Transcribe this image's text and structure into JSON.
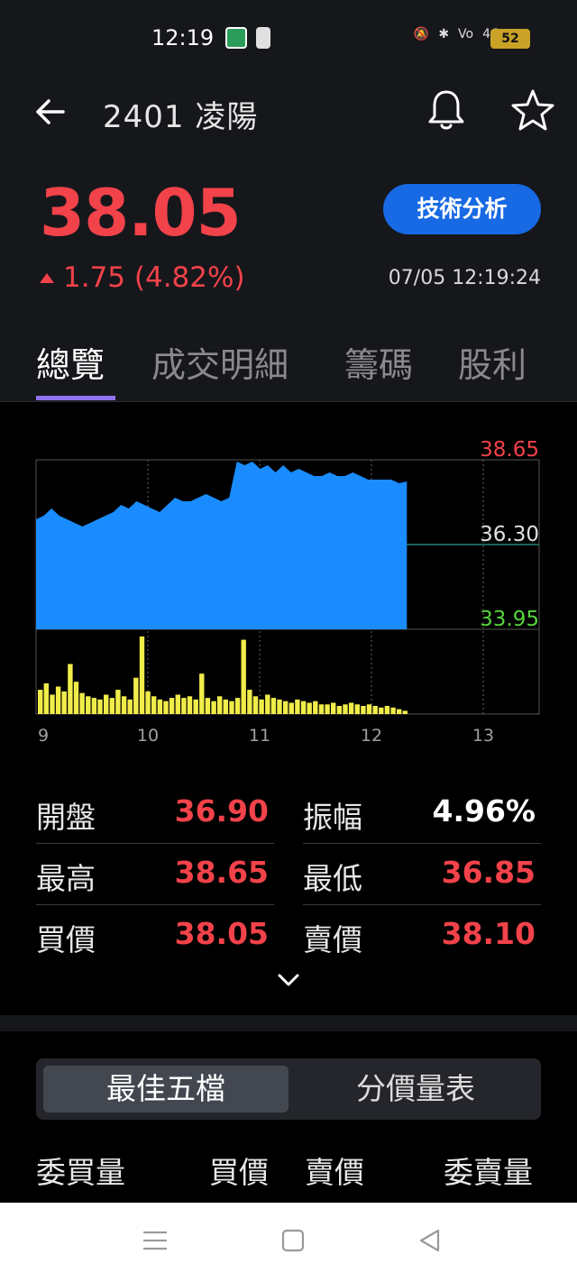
{
  "status": {
    "time": "12:19",
    "network": "4G",
    "battery": "52"
  },
  "header": {
    "title": "2401 凌陽"
  },
  "quote": {
    "price": "38.05",
    "change": "1.75 (4.82%)",
    "timestamp": "07/05 12:19:24",
    "ta_button": "技術分析"
  },
  "tabs": [
    "總覽",
    "成交明細",
    "籌碼",
    "股利"
  ],
  "chart_data": {
    "type": "area",
    "y_labels": {
      "high": "38.65",
      "ref": "36.30",
      "low": "33.95"
    },
    "ylim": [
      33.95,
      38.65
    ],
    "reference": 36.3,
    "x_ticks": [
      "9",
      "10",
      "11",
      "12",
      "13"
    ],
    "series": [
      {
        "values": [
          37.0,
          37.1,
          37.3,
          37.1,
          37.0,
          36.9,
          36.8,
          36.9,
          37.0,
          37.1,
          37.2,
          37.4,
          37.3,
          37.5,
          37.4,
          37.3,
          37.2,
          37.4,
          37.6,
          37.5,
          37.5,
          37.6,
          37.7,
          37.6,
          37.5,
          37.6,
          38.6,
          38.5,
          38.6,
          38.4,
          38.5,
          38.3,
          38.5,
          38.3,
          38.4,
          38.3,
          38.2,
          38.2,
          38.3,
          38.2,
          38.2,
          38.3,
          38.2,
          38.1,
          38.1,
          38.1,
          38.1,
          38.0,
          38.05
        ]
      }
    ],
    "volume": [
      30,
      38,
      24,
      34,
      28,
      62,
      40,
      26,
      22,
      20,
      18,
      24,
      20,
      30,
      22,
      18,
      45,
      96,
      28,
      22,
      18,
      16,
      20,
      24,
      20,
      22,
      18,
      50,
      20,
      16,
      22,
      18,
      16,
      20,
      92,
      30,
      22,
      18,
      24,
      20,
      18,
      16,
      14,
      18,
      16,
      14,
      16,
      12,
      12,
      14,
      10,
      12,
      14,
      12,
      10,
      12,
      10,
      8,
      10,
      8,
      6,
      4
    ]
  },
  "stats": [
    {
      "label": "開盤",
      "value": "36.90",
      "color": "#f2424a"
    },
    {
      "label": "振幅",
      "value": "4.96%",
      "color": "#ffffff"
    },
    {
      "label": "最高",
      "value": "38.65",
      "color": "#f2424a"
    },
    {
      "label": "最低",
      "value": "36.85",
      "color": "#f2424a"
    },
    {
      "label": "買價",
      "value": "38.05",
      "color": "#f2424a"
    },
    {
      "label": "賣價",
      "value": "38.10",
      "color": "#f2424a"
    }
  ],
  "orderbook": {
    "seg_active": "最佳五檔",
    "seg_inactive": "分價量表",
    "headers": [
      "委買量",
      "買價",
      "賣價",
      "委賣量"
    ]
  },
  "colors": {
    "up": "#f2424a",
    "down": "#55d43d",
    "area": "#1a8cff",
    "volume": "#f0ec4a",
    "accent": "#1769e4"
  }
}
